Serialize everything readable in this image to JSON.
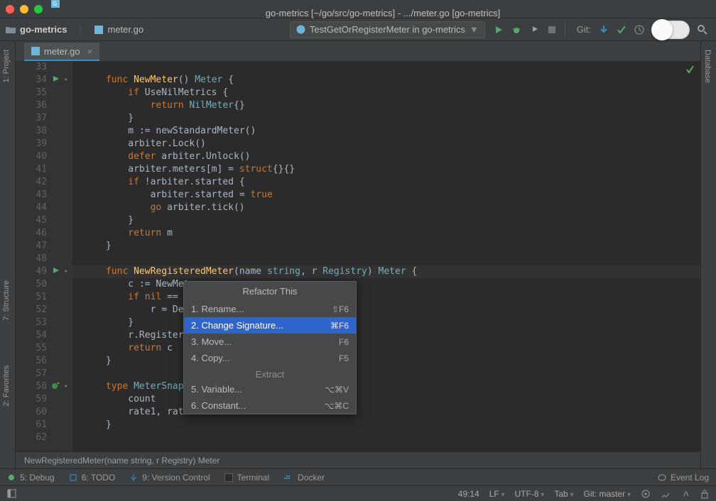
{
  "titlebar": {
    "title": "go-metrics [~/go/src/go-metrics] - .../meter.go [go-metrics]"
  },
  "navbar": {
    "project": "go-metrics",
    "file": "meter.go",
    "run_config": "TestGetOrRegisterMeter in go-metrics",
    "git_label": "Git:"
  },
  "rails": {
    "left": {
      "project": "1: Project",
      "structure": "7: Structure",
      "favorites": "2: Favorites"
    },
    "right": {
      "database": "Database"
    }
  },
  "tab": {
    "name": "meter.go"
  },
  "code": {
    "lines": [
      {
        "n": 33,
        "html": ""
      },
      {
        "n": 34,
        "html": "<span class='kw'>func</span> <span class='fn'>NewMeter</span><span class='punc'>()</span> <span class='typ'>Meter</span> <span class='punc'>{</span>"
      },
      {
        "n": 35,
        "html": "    <span class='kw'>if</span> <span class='id'>UseNilMetrics</span> <span class='punc'>{</span>"
      },
      {
        "n": 36,
        "html": "        <span class='kw'>return</span> <span class='typ'>NilMeter</span><span class='punc'>{}</span>"
      },
      {
        "n": 37,
        "html": "    <span class='punc'>}</span>"
      },
      {
        "n": 38,
        "html": "    <span class='id'>m</span> <span class='op'>:=</span> <span class='id'>newStandardMeter()</span>"
      },
      {
        "n": 39,
        "html": "    <span class='id'>arbiter.Lock()</span>"
      },
      {
        "n": 40,
        "html": "    <span class='kw'>defer</span> <span class='id'>arbiter.Unlock()</span>"
      },
      {
        "n": 41,
        "html": "    <span class='id'>arbiter.meters[m]</span> <span class='op'>=</span> <span class='kw'>struct</span><span class='punc'>{}{}</span>"
      },
      {
        "n": 42,
        "html": "    <span class='kw'>if</span> <span class='op'>!</span><span class='id'>arbiter.started</span> <span class='punc'>{</span>"
      },
      {
        "n": 43,
        "html": "        <span class='id'>arbiter.started</span> <span class='op'>=</span> <span class='bool'>true</span>"
      },
      {
        "n": 44,
        "html": "        <span class='kw'>go</span> <span class='id'>arbiter.tick()</span>"
      },
      {
        "n": 45,
        "html": "    <span class='punc'>}</span>"
      },
      {
        "n": 46,
        "html": "    <span class='kw'>return</span> <span class='id'>m</span>"
      },
      {
        "n": 47,
        "html": "<span class='punc'>}</span>"
      },
      {
        "n": 48,
        "html": ""
      },
      {
        "n": 49,
        "html": "<span class='kw'>func</span> <span class='fn'>NewRegisteredMeter</span><span class='punc'>(</span><span class='id'>name</span> <span class='typ'>string</span><span class='punc'>,</span> <span class='id'>r</span> <span class='typ'>Registry</span><span class='punc'>)</span> <span class='typ'>Meter</span> <span class='punc'>{</span>",
        "current": true
      },
      {
        "n": 50,
        "html": "    <span class='id'>c</span> <span class='op'>:=</span> <span class='id'>NewMete</span>"
      },
      {
        "n": 51,
        "html": "    <span class='kw'>if</span> <span class='bool'>nil</span> <span class='op'>==</span> <span class='id'>r</span>"
      },
      {
        "n": 52,
        "html": "        <span class='id'>r</span> <span class='op'>=</span> <span class='id'>Defa</span>"
      },
      {
        "n": 53,
        "html": "    <span class='punc'>}</span>"
      },
      {
        "n": 54,
        "html": "    <span class='id'>r.Register(n</span>"
      },
      {
        "n": 55,
        "html": "    <span class='kw'>return</span> <span class='id'>c</span>"
      },
      {
        "n": 56,
        "html": "<span class='punc'>}</span>"
      },
      {
        "n": 57,
        "html": ""
      },
      {
        "n": 58,
        "html": "<span class='kw'>type</span> <span class='typ'>MeterSnapsh</span>"
      },
      {
        "n": 59,
        "html": "    <span class='id'>count</span>"
      },
      {
        "n": 60,
        "html": "    <span class='id'>rate1, rate5</span>"
      },
      {
        "n": 61,
        "html": "<span class='punc'>}</span>"
      },
      {
        "n": 62,
        "html": ""
      }
    ],
    "breadcrumb": "NewRegisteredMeter(name string, r Registry) Meter"
  },
  "popup": {
    "title": "Refactor This",
    "section": "Extract",
    "items_top": [
      {
        "label": "1. Rename...",
        "shortcut": "⇧F6"
      },
      {
        "label": "2. Change Signature...",
        "shortcut": "⌘F6",
        "selected": true
      },
      {
        "label": "3. Move...",
        "shortcut": "F6"
      },
      {
        "label": "4. Copy...",
        "shortcut": "F5"
      }
    ],
    "items_bottom": [
      {
        "label": "5. Variable...",
        "shortcut": "⌥⌘V"
      },
      {
        "label": "6. Constant...",
        "shortcut": "⌥⌘C"
      }
    ]
  },
  "bottom": {
    "tools": [
      {
        "name": "5: Debug"
      },
      {
        "name": "6: TODO"
      },
      {
        "name": "9: Version Control"
      },
      {
        "name": "Terminal"
      },
      {
        "name": "Docker"
      }
    ],
    "event_log": "Event Log"
  },
  "status": {
    "pos": "49:14",
    "le": "LF",
    "enc": "UTF-8",
    "indent": "Tab",
    "git": "Git: master"
  }
}
